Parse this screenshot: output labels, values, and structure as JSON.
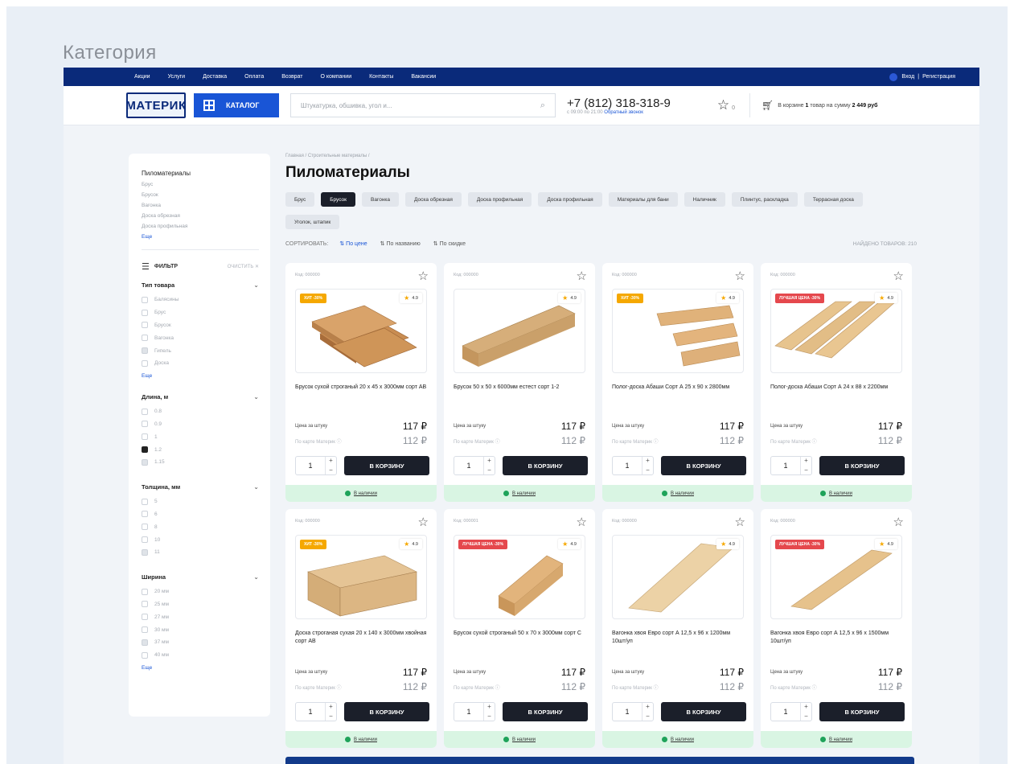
{
  "page_caption": "Категория",
  "topnav": {
    "links": [
      "Акции",
      "Услуги",
      "Доставка",
      "Оплата",
      "Возврат",
      "О компании",
      "Контакты",
      "Вакансии"
    ],
    "login": "Вход",
    "separator": "|",
    "register": "Регистрация"
  },
  "header": {
    "logo_text": "МАТЕРИК",
    "catalog_label": "КАТАЛОГ",
    "search_placeholder": "Штукатурка, обшивка, угол и...",
    "phone": "+7 (812) 318-318-9",
    "phone_hours": "с 09:00 по 21:00",
    "callback": "Обратный звонок",
    "favorites_count": "0",
    "cart_prefix": "В корзине",
    "cart_count": "1",
    "cart_mid": "товар на сумму",
    "cart_sum": "2 449 руб"
  },
  "sidebar": {
    "category_title": "Пиломатериалы",
    "category_links": [
      "Брус",
      "Брусок",
      "Вагонка",
      "Доска обрезная",
      "Доска профильная"
    ],
    "category_more": "Еще",
    "filter_title": "ФИЛЬТР",
    "filter_clear": "ОЧИСТИТЬ",
    "groups": [
      {
        "title": "Тип товара",
        "options": [
          "Балясины",
          "Брус",
          "Брусок",
          "Вагонка",
          "Гипель",
          "Доска"
        ],
        "more": "Еще"
      },
      {
        "title": "Длина, м",
        "options": [
          "0.8",
          "0.9",
          "1",
          "1.2",
          "1.15"
        ],
        "more": ""
      },
      {
        "title": "Толщина, мм",
        "options": [
          "5",
          "6",
          "8",
          "10",
          "11"
        ],
        "more": ""
      },
      {
        "title": "Ширина",
        "options": [
          "20 мм",
          "25 мм",
          "27 мм",
          "30 мм",
          "37 мм",
          "40 мм"
        ],
        "more": "Еще"
      }
    ]
  },
  "main": {
    "breadcrumbs": "Главная / Строительные материалы /",
    "title": "Пиломатериалы",
    "chips": [
      "Брус",
      "Брусок",
      "Вагонка",
      "Доска обрезная",
      "Доска профильная",
      "Доска профильная",
      "Материалы для бани",
      "Наличник",
      "Плинтус, раскладка",
      "Террасная доска",
      "Уголок, штапик"
    ],
    "active_chip": 1,
    "sort_label": "СОРТИРОВАТЬ:",
    "sort_options": [
      "По цене",
      "По названию",
      "По скидке"
    ],
    "found": "НАЙДЕНО ТОВАРОВ: 210"
  },
  "card_labels": {
    "price_label": "Цена за штуку",
    "card_price_label": "По карте Материк",
    "buy_label": "В КОРЗИНУ",
    "availability": "В наличии",
    "price": "117 ₽",
    "card_price": "112 ₽",
    "qty": "1",
    "rating": "4.9"
  },
  "products": [
    {
      "code": "Код: 000000",
      "badge": "ХИТ -30%",
      "name": "Брусок сухой строганый 20 х 45 х 3000мм сорт АВ"
    },
    {
      "code": "Код: 000000",
      "badge": "",
      "name": "Брусок 50 х 50 х 6000мм естест сорт 1-2"
    },
    {
      "code": "Код: 000000",
      "badge": "ХИТ -30%",
      "name": "Полог-доска Абаши Сорт А 25 х 90 х 2800мм"
    },
    {
      "code": "Код: 000000",
      "badge": "ЛУЧШАЯ ЦЕНА -30%",
      "name": "Полог-доска Абаши Сорт А 24 х 88 х 2200мм"
    },
    {
      "code": "Код: 000000",
      "badge": "ХИТ -30%",
      "name": "Доска строганая сухая 20 х 140 х 3000мм хвойная сорт АВ"
    },
    {
      "code": "Код: 000001",
      "badge": "ЛУЧШАЯ ЦЕНА -30%",
      "name": "Брусок сухой строганый 50 х 70 х 3000мм сорт С"
    },
    {
      "code": "Код: 000000",
      "badge": "",
      "name": "Вагонка хвоя Евро сорт А 12,5 х 96 х 1200мм 10шт/уп"
    },
    {
      "code": "Код: 000000",
      "badge": "ЛУЧШАЯ ЦЕНА -30%",
      "name": "Вагонка хвоя Евро сорт А 12,5 х 96 х 1500мм 10шт/уп"
    }
  ],
  "colors": {
    "navy": "#0a2a7a",
    "brand_blue": "#1955d6",
    "dark_button": "#1b1f2a",
    "availability_bg": "#d9f5e3",
    "badge_hit": "#f5a800",
    "badge_best": "#e5484d"
  }
}
